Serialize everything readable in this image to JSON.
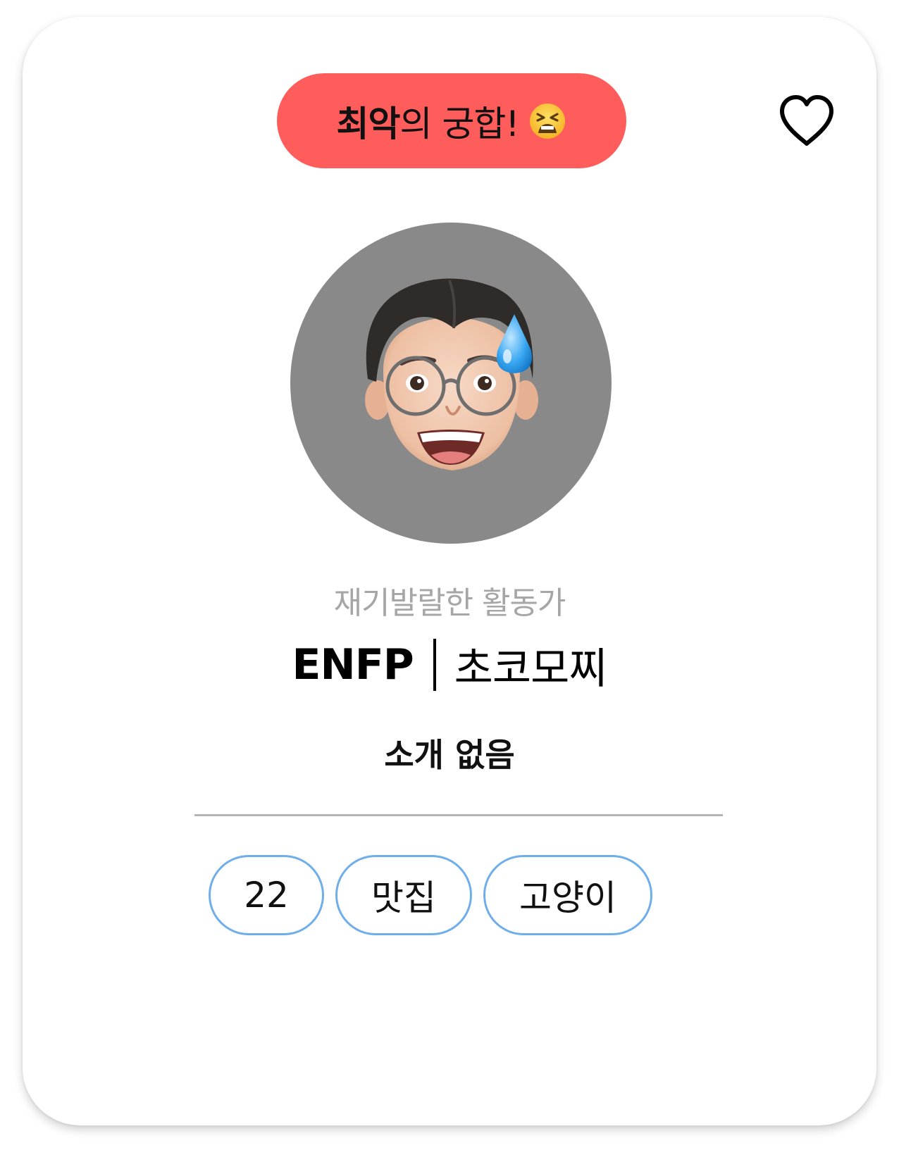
{
  "badge": {
    "strong": "최악",
    "rest": "의 궁합!",
    "emoji_icon": "tired-face-emoji-icon",
    "color": "#ff5c5c"
  },
  "favorite": {
    "icon": "heart-outline-icon"
  },
  "profile": {
    "avatar_icon": "memoji-avatar-with-sweat-drop",
    "avatar_bg": "#898989",
    "type_description": "재기발랄한 활동가",
    "mbti": "ENFP",
    "nickname": "초코모찌",
    "intro": "소개 없음"
  },
  "tags": [
    {
      "label": "22"
    },
    {
      "label": "맛집"
    },
    {
      "label": "고양이"
    }
  ],
  "colors": {
    "tag_border": "#70aeea",
    "divider": "#b4b4b4",
    "subtitle": "#a6a6a6"
  }
}
